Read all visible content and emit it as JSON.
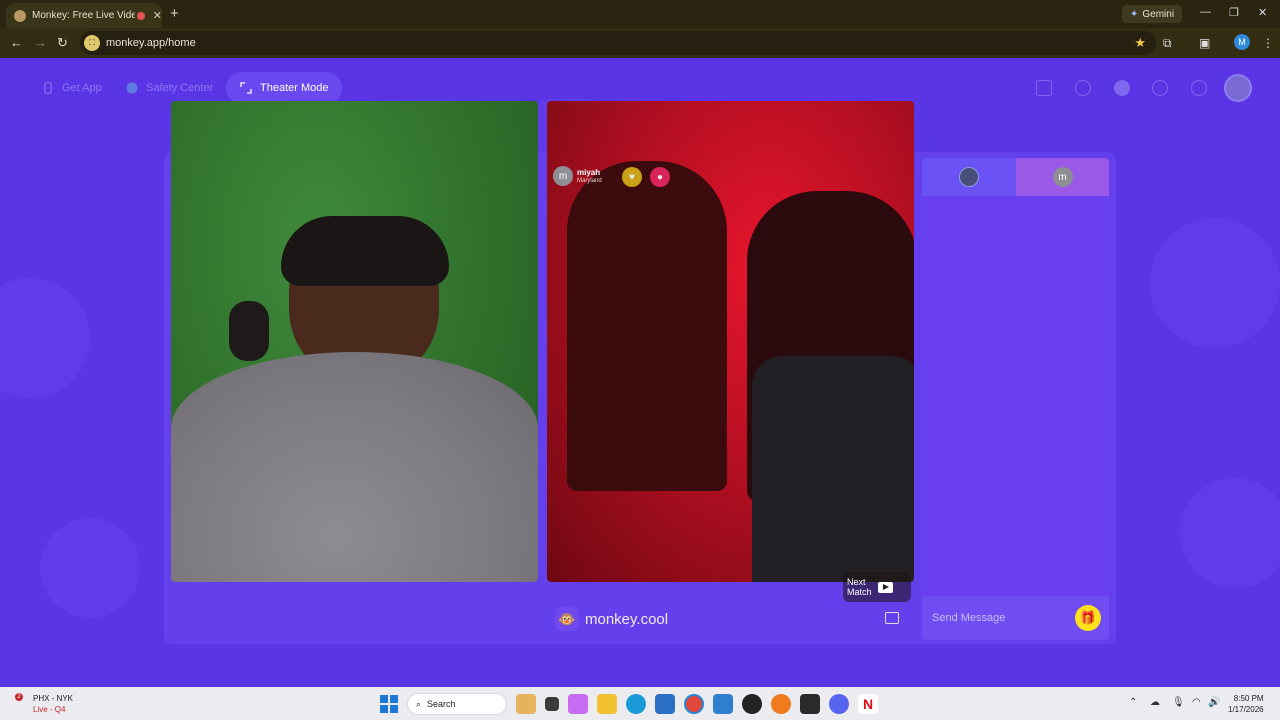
{
  "browser": {
    "tab_title": "Monkey: Free Live Video Ch",
    "new_tab_symbol": "+",
    "url": "monkey.app/home",
    "gemini_label": "Gemini",
    "profile_initial": "M"
  },
  "topbar": {
    "get_app_label": "Get App",
    "safety_center_label": "Safety Center",
    "theater_mode_label": "Theater Mode"
  },
  "remote_user": {
    "initial": "m",
    "name": "miyah",
    "location": "Maryland"
  },
  "video_overlay": {
    "watermark": "monkey.cool",
    "next_match_line1": "Next",
    "next_match_line2": "Match"
  },
  "chat": {
    "tab2_initial": "m",
    "input_placeholder": "Send Message"
  },
  "taskbar": {
    "score_line1": "PHX - NYK",
    "score_line2": "Live - Q4",
    "score_badge": "2",
    "search_label": "Search",
    "time": "8:50 PM",
    "date": "1/17/2026"
  },
  "colors": {
    "page_bg": "#5a35e6",
    "chat_panel": "#6a3ff0",
    "gift_button": "#ffe01a"
  },
  "icons": [
    "app-phone-icon",
    "shield-icon",
    "expand-icon",
    "gift-box-icon",
    "search-icon",
    "avatar-icon",
    "history-icon",
    "chat-icon",
    "play-icon",
    "report-icon"
  ]
}
